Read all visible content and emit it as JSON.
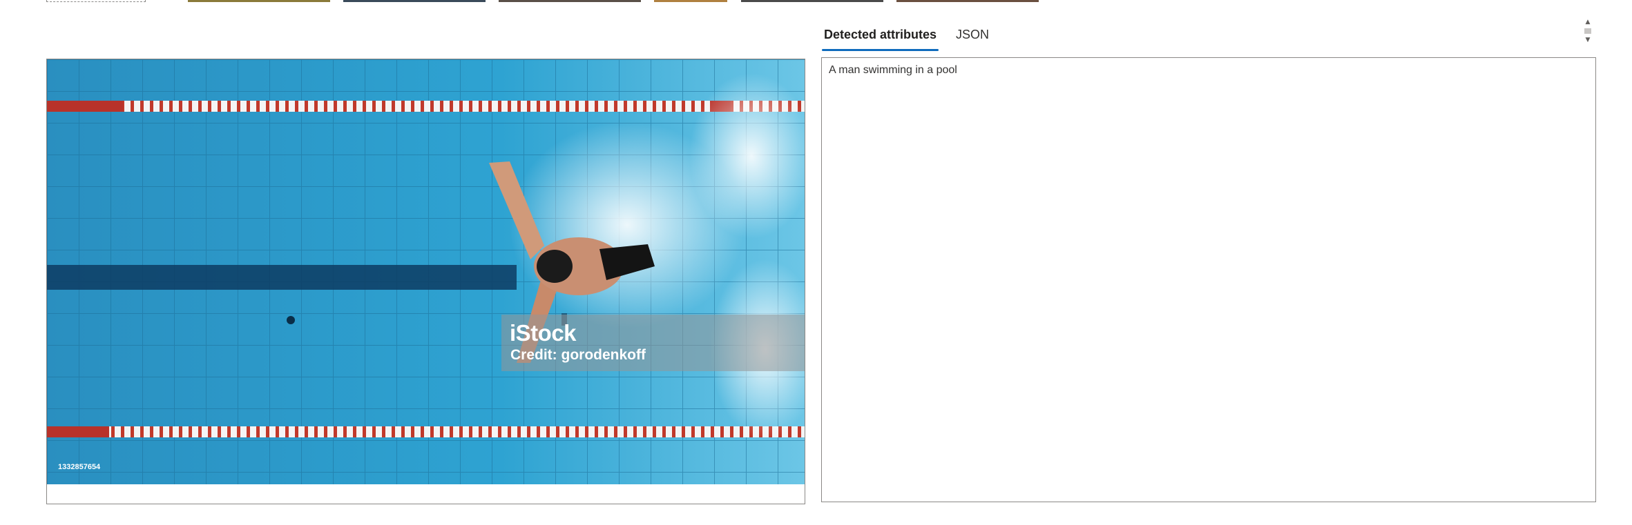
{
  "tabs": [
    {
      "label": "Detected attributes",
      "active": true
    },
    {
      "label": "JSON",
      "active": false
    }
  ],
  "result": {
    "caption": "A man swimming in a pool"
  },
  "preview": {
    "watermark_logo": "iStock",
    "watermark_credit": "Credit: gorodenkoff",
    "image_id": "1332857654"
  },
  "icons": {
    "scroll_up": "chevron-up-icon",
    "scroll_down": "chevron-down-icon"
  },
  "colors": {
    "accent": "#0f6cbd",
    "water": "#2e9bcc",
    "lane_red": "#c0392b"
  }
}
